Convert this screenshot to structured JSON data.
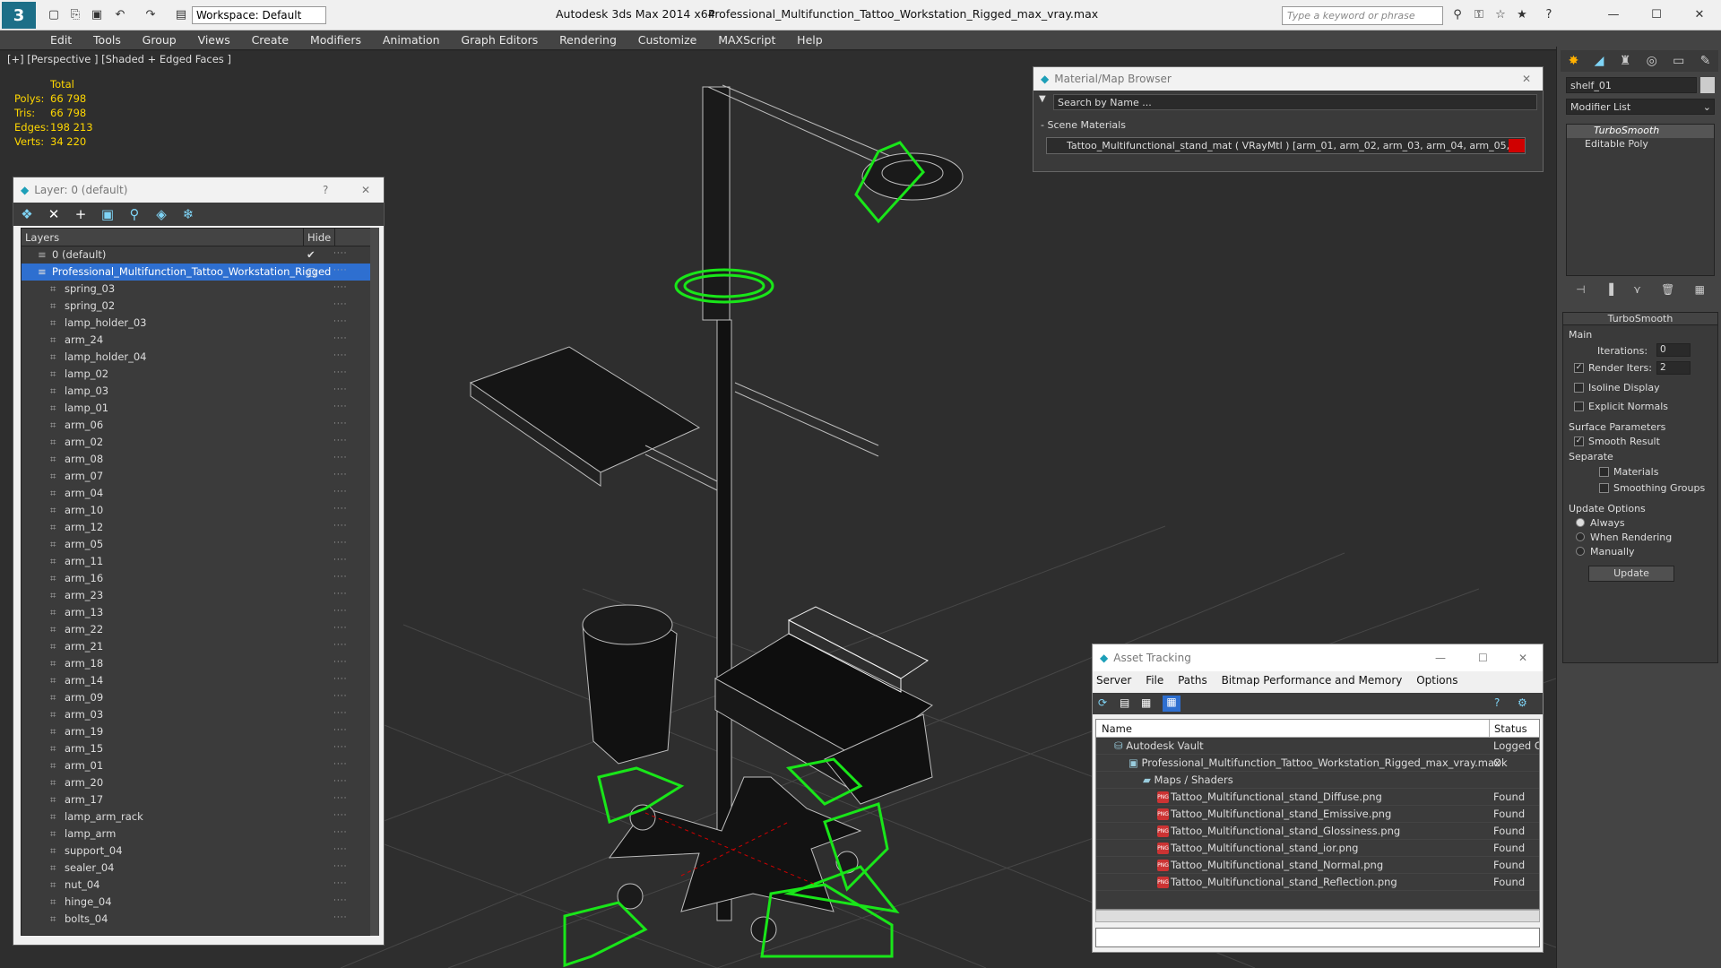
{
  "window": {
    "app_title": "Autodesk 3ds Max  2014 x64",
    "file_title": "Professional_Multifunction_Tattoo_Workstation_Rigged_max_vray.max",
    "workspace": "Workspace: Default",
    "search_placeholder": "Type a keyword or phrase"
  },
  "menu": [
    "Edit",
    "Tools",
    "Group",
    "Views",
    "Create",
    "Modifiers",
    "Animation",
    "Graph Editors",
    "Rendering",
    "Customize",
    "MAXScript",
    "Help"
  ],
  "viewport": {
    "label": "[+] [Perspective ] [Shaded + Edged Faces ]",
    "stats_header": "Total",
    "stats": [
      {
        "k": "Polys:",
        "v": "66 798"
      },
      {
        "k": "Tris:",
        "v": "66 798"
      },
      {
        "k": "Edges:",
        "v": "198 213"
      },
      {
        "k": "Verts:",
        "v": "34 220"
      }
    ]
  },
  "layer_panel": {
    "title": "Layer: 0 (default)",
    "help": "?",
    "col_layers": "Layers",
    "col_hide": "Hide",
    "default_layer": "0 (default)",
    "selected_layer": "Professional_Multifunction_Tattoo_Workstation_Rigged",
    "items": [
      "spring_03",
      "spring_02",
      "lamp_holder_03",
      "arm_24",
      "lamp_holder_04",
      "lamp_02",
      "lamp_03",
      "lamp_01",
      "arm_06",
      "arm_02",
      "arm_08",
      "arm_07",
      "arm_04",
      "arm_10",
      "arm_12",
      "arm_05",
      "arm_11",
      "arm_16",
      "arm_23",
      "arm_13",
      "arm_22",
      "arm_21",
      "arm_18",
      "arm_14",
      "arm_09",
      "arm_03",
      "arm_19",
      "arm_15",
      "arm_01",
      "arm_20",
      "arm_17",
      "lamp_arm_rack",
      "lamp_arm",
      "support_04",
      "sealer_04",
      "nut_04",
      "hinge_04",
      "bolts_04"
    ]
  },
  "material_browser": {
    "title": "Material/Map Browser",
    "search": "Search by Name ...",
    "section": "Scene Materials",
    "entry": "Tattoo_Multifunctional_stand_mat  ( VRayMtl )  [arm_01, arm_02, arm_03, arm_04, arm_05, arm_..."
  },
  "asset_tracking": {
    "title": "Asset Tracking",
    "menu": [
      "Server",
      "File",
      "Paths",
      "Bitmap Performance and Memory",
      "Options"
    ],
    "col_name": "Name",
    "col_status": "Status",
    "rows": [
      {
        "name": "Autodesk Vault",
        "status": "Logged C",
        "indent": 20,
        "icon": "vault"
      },
      {
        "name": "Professional_Multifunction_Tattoo_Workstation_Rigged_max_vray.max",
        "status": "Ok",
        "indent": 36,
        "icon": "max"
      },
      {
        "name": "Maps / Shaders",
        "status": "",
        "indent": 52,
        "icon": "folder"
      },
      {
        "name": "Tattoo_Multifunctional_stand_Diffuse.png",
        "status": "Found",
        "indent": 68,
        "icon": "png"
      },
      {
        "name": "Tattoo_Multifunctional_stand_Emissive.png",
        "status": "Found",
        "indent": 68,
        "icon": "png"
      },
      {
        "name": "Tattoo_Multifunctional_stand_Glossiness.png",
        "status": "Found",
        "indent": 68,
        "icon": "png"
      },
      {
        "name": "Tattoo_Multifunctional_stand_ior.png",
        "status": "Found",
        "indent": 68,
        "icon": "png"
      },
      {
        "name": "Tattoo_Multifunctional_stand_Normal.png",
        "status": "Found",
        "indent": 68,
        "icon": "png"
      },
      {
        "name": "Tattoo_Multifunctional_stand_Reflection.png",
        "status": "Found",
        "indent": 68,
        "icon": "png"
      }
    ]
  },
  "command_panel": {
    "object_name": "shelf_01",
    "modifier_list": "Modifier List",
    "stack": [
      "TurboSmooth",
      "Editable Poly"
    ],
    "rollout_title": "TurboSmooth",
    "main": "Main",
    "iterations_label": "Iterations:",
    "iterations": "0",
    "render_iters_label": "Render Iters:",
    "render_iters": "2",
    "isoline": "Isoline Display",
    "explicit_normals": "Explicit Normals",
    "surface_params": "Surface Parameters",
    "smooth_result": "Smooth Result",
    "separate": "Separate",
    "materials": "Materials",
    "smoothing_groups": "Smoothing Groups",
    "update_options": "Update Options",
    "always": "Always",
    "when_rendering": "When Rendering",
    "manually": "Manually",
    "update_btn": "Update"
  },
  "colors": {
    "accent": "#2e6fd0",
    "gizmo": "#19e619",
    "stats": "#ffd700",
    "error": "#d00000"
  }
}
